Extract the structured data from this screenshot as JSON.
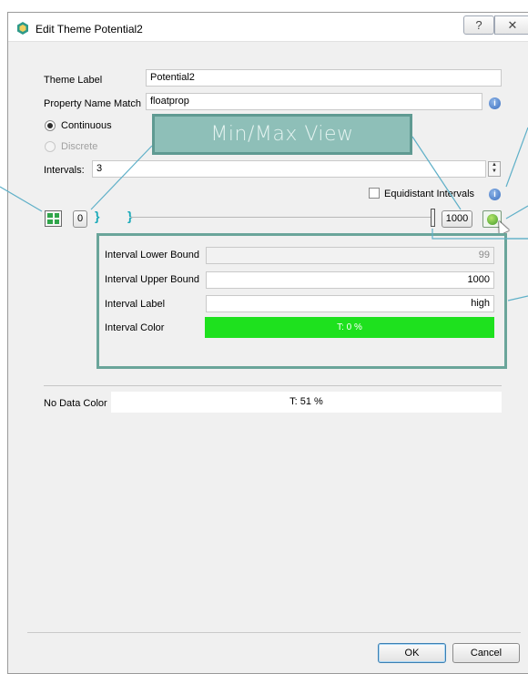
{
  "window": {
    "title": "Edit Theme Potential2",
    "help_label": "?",
    "close_label": "✕"
  },
  "form": {
    "theme_label": {
      "label": "Theme Label",
      "value": "Potential2"
    },
    "property_name_match": {
      "label": "Property Name Match",
      "value": "floatprop"
    },
    "mode": {
      "options": [
        {
          "label": "Continuous",
          "selected": true,
          "enabled": true
        },
        {
          "label": "Discrete",
          "selected": false,
          "enabled": false
        }
      ]
    },
    "intervals": {
      "label": "Intervals:",
      "value": "3"
    },
    "equidistant": {
      "label": "Equidistant Intervals",
      "checked": false
    }
  },
  "slider": {
    "min_value": "0",
    "max_value": "1000"
  },
  "interval_detail": {
    "lower_bound": {
      "label": "Interval Lower Bound",
      "value": "99"
    },
    "upper_bound": {
      "label": "Interval Upper Bound",
      "value": "1000"
    },
    "interval_label": {
      "label": "Interval Label",
      "value": "high"
    },
    "interval_color": {
      "label": "Interval Color",
      "value": "T: 0 %",
      "color": "#1ee11e"
    }
  },
  "no_data": {
    "label": "No Data Color",
    "value": "T: 51 %"
  },
  "buttons": {
    "ok": "OK",
    "cancel": "Cancel"
  },
  "annotation": {
    "text": "Min/Max View"
  },
  "colors": {
    "accent": "#6aa59a",
    "callout": "#5fb0c8",
    "interval_color": "#1ee11e"
  }
}
